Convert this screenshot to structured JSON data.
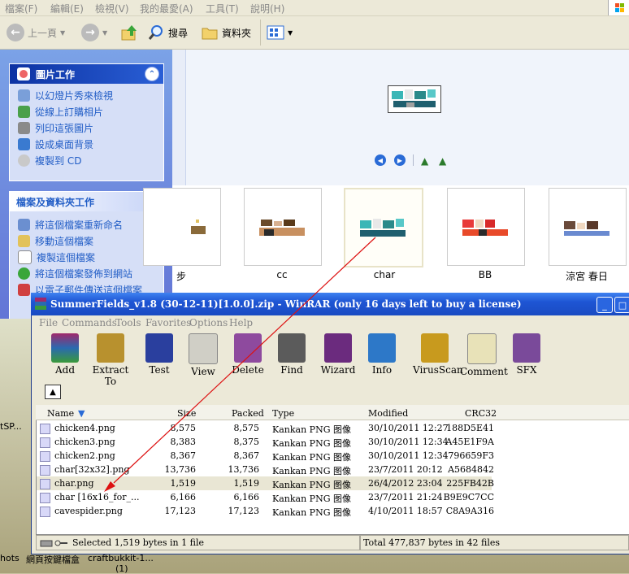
{
  "explorer": {
    "menu": [
      "檔案(F)",
      "編輯(E)",
      "檢視(V)",
      "我的最愛(A)",
      "工具(T)",
      "說明(H)"
    ],
    "toolbar": {
      "back": "上一頁",
      "search": "搜尋",
      "folders": "資料夾"
    },
    "panels": [
      {
        "title": "圖片工作",
        "tasks": [
          "以幻燈片秀來檢視",
          "從線上訂購相片",
          "列印這張圖片",
          "設成桌面背景",
          "複製到 CD"
        ]
      },
      {
        "title": "檔案及資料夾工作",
        "tasks": [
          "將這個檔案重新命名",
          "移動這個檔案",
          "複製這個檔案",
          "將這個檔案發佈到網站",
          "以電子郵件傳送這個檔案"
        ]
      }
    ],
    "thumbnails": [
      {
        "label": "步"
      },
      {
        "label": "cc"
      },
      {
        "label": "char"
      },
      {
        "label": "BB"
      },
      {
        "label": "涼宮 春日"
      }
    ]
  },
  "winrar": {
    "title": "SummerFields_v1.8 (30-12-11)[1.0.0].zip - WinRAR (only 16 days left to buy a license)",
    "menu": [
      "File",
      "Commands",
      "Tools",
      "Favorites",
      "Options",
      "Help"
    ],
    "toolbar": [
      {
        "label": "Add",
        "icon": "add-icon",
        "color": "#8b4a2a"
      },
      {
        "label": "Extract To",
        "icon": "extract-icon",
        "color": "#b8912e"
      },
      {
        "label": "Test",
        "icon": "test-icon",
        "color": "#2a3f9e"
      },
      {
        "label": "View",
        "icon": "view-icon",
        "color": "#d0cfc6"
      },
      {
        "label": "Delete",
        "icon": "delete-icon",
        "color": "#8e4a9e"
      },
      {
        "label": "Find",
        "icon": "find-icon",
        "color": "#5b5b5b"
      },
      {
        "label": "Wizard",
        "icon": "wizard-icon",
        "color": "#6b2b7e"
      },
      {
        "label": "Info",
        "icon": "info-icon",
        "color": "#2d78c8"
      },
      {
        "label": "VirusScan",
        "icon": "virusscan-icon",
        "color": "#c89a1e"
      },
      {
        "label": "Comment",
        "icon": "comment-icon",
        "color": "#e8e2b8"
      },
      {
        "label": "SFX",
        "icon": "sfx-icon",
        "color": "#7a4a9a"
      }
    ],
    "columns": {
      "name": "Name",
      "size": "Size",
      "packed": "Packed",
      "type": "Type",
      "modified": "Modified",
      "crc": "CRC32"
    },
    "files": [
      {
        "name": "chicken4.png",
        "size": "8,575",
        "packed": "8,575",
        "type": "Kankan PNG 图像",
        "modified": "30/10/2011 12:27",
        "crc": "188D5E41"
      },
      {
        "name": "chicken3.png",
        "size": "8,383",
        "packed": "8,375",
        "type": "Kankan PNG 图像",
        "modified": "30/10/2011 12:34",
        "crc": "A45E1F9A"
      },
      {
        "name": "chicken2.png",
        "size": "8,367",
        "packed": "8,367",
        "type": "Kankan PNG 图像",
        "modified": "30/10/2011 12:34",
        "crc": "796659F3"
      },
      {
        "name": "char[32x32].png",
        "size": "13,736",
        "packed": "13,736",
        "type": "Kankan PNG 图像",
        "modified": "23/7/2011 20:12",
        "crc": "A5684842"
      },
      {
        "name": "char.png",
        "size": "1,519",
        "packed": "1,519",
        "type": "Kankan PNG 图像",
        "modified": "26/4/2012 23:04",
        "crc": "225FB42B",
        "selected": true
      },
      {
        "name": "char [16x16_for_...",
        "size": "6,166",
        "packed": "6,166",
        "type": "Kankan PNG 图像",
        "modified": "23/7/2011 21:24",
        "crc": "B9E9C7CC"
      },
      {
        "name": "cavespider.png",
        "size": "17,123",
        "packed": "17,123",
        "type": "Kankan PNG 图像",
        "modified": "4/10/2011 18:57",
        "crc": "C8A9A316"
      }
    ],
    "status_left": "Selected 1,519 bytes in 1 file",
    "status_right": "Total 477,837 bytes in 42 files"
  },
  "desktop": {
    "labels": [
      "tSP...",
      "hots",
      "網頁按鍵檔盒",
      "craftbukkit-1...",
      "(1)"
    ]
  }
}
